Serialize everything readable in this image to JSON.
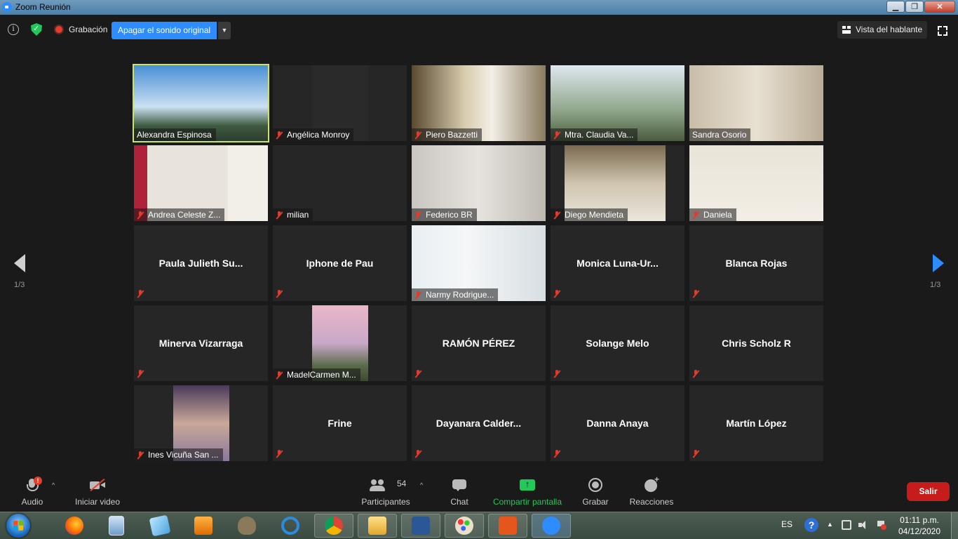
{
  "window": {
    "title": "Zoom Reunión",
    "minimize": "▁",
    "restore": "❐",
    "close": "✕"
  },
  "topbar": {
    "info": "i",
    "recording_label": "Grabación",
    "original_sound_button": "Apagar el sonido original",
    "dropdown_caret": "▼",
    "speaker_view": "Vista del hablante"
  },
  "gallery": {
    "page_indicator_left": "1/3",
    "page_indicator_right": "1/3",
    "tiles": [
      {
        "name": "Alexandra Espinosa",
        "video": true,
        "muted": false,
        "active": true
      },
      {
        "name": "Angélica Monroy",
        "video": true,
        "muted": true
      },
      {
        "name": "Piero Bazzetti",
        "video": true,
        "muted": true
      },
      {
        "name": "Mtra. Claudia Va...",
        "video": true,
        "muted": true
      },
      {
        "name": "Sandra Osorio",
        "video": true,
        "muted": false
      },
      {
        "name": "Andrea Celeste Z...",
        "video": true,
        "muted": true
      },
      {
        "name": "milian",
        "video": false,
        "muted": true,
        "label_only": true
      },
      {
        "name": "Federico BR",
        "video": true,
        "muted": true
      },
      {
        "name": "Diego Mendieta",
        "video": true,
        "muted": true
      },
      {
        "name": "Daniela",
        "video": true,
        "muted": true
      },
      {
        "name": "Paula Julieth Su...",
        "video": false,
        "muted": true
      },
      {
        "name": "Iphone de Pau ",
        "video": false,
        "muted": true
      },
      {
        "name": "Narmy Rodrigue...",
        "video": true,
        "muted": true
      },
      {
        "name": "Monica Luna-Ur...",
        "video": false,
        "muted": true
      },
      {
        "name": "Blanca Rojas",
        "video": false,
        "muted": true
      },
      {
        "name": "Minerva Vizarraga",
        "video": false,
        "muted": true
      },
      {
        "name": "MadelCarmen M...",
        "video": true,
        "muted": true
      },
      {
        "name": "RAMÓN PÉREZ",
        "video": false,
        "muted": true
      },
      {
        "name": "Solange Melo",
        "video": false,
        "muted": true
      },
      {
        "name": "Chris Scholz R",
        "video": false,
        "muted": true
      },
      {
        "name": "Ines Vicuña San ...",
        "video": true,
        "muted": true
      },
      {
        "name": "Frine",
        "video": false,
        "muted": true
      },
      {
        "name": "Dayanara Calder...",
        "video": false,
        "muted": true
      },
      {
        "name": "Danna Anaya",
        "video": false,
        "muted": true
      },
      {
        "name": "Martín López",
        "video": false,
        "muted": true
      }
    ]
  },
  "toolbar": {
    "audio": "Audio",
    "audio_alert": "!",
    "caret": "^",
    "start_video": "Iniciar video",
    "participants": "Participantes",
    "participants_count": "54",
    "chat": "Chat",
    "share_screen": "Compartir pantalla",
    "record": "Grabar",
    "reactions": "Reacciones",
    "leave": "Salir"
  },
  "taskbar": {
    "language": "ES",
    "help": "?",
    "tray_expand": "▲",
    "time": "01:11 p.m.",
    "date": "04/12/2020"
  },
  "colors": {
    "accent": "#2d8cff",
    "share_green": "#23c85a",
    "leave_red": "#c71c1c",
    "active_speaker": "#c9e46b",
    "mute_red": "#e23b2c"
  }
}
